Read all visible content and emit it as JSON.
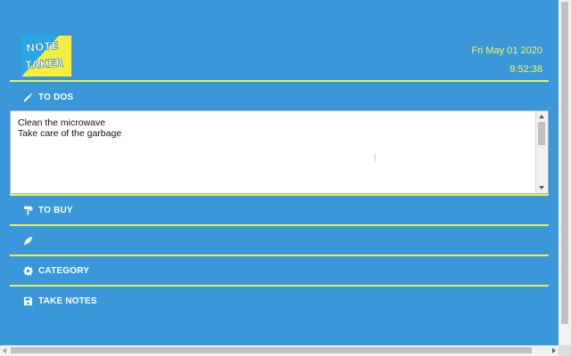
{
  "header": {
    "logo_line1": "NOTE",
    "logo_line2": "TAKER",
    "date": "Fri May 01 2020",
    "time": "9:52:38"
  },
  "sections": {
    "todos": "TO DOS",
    "tobuy": "TO BUY",
    "leaf": "",
    "category": "CATEGORY",
    "notes": "TAKE NOTES"
  },
  "todos_text": "Clean the microwave\nTake care of the garbage",
  "colors": {
    "background": "#3a97da",
    "accent_yellow": "#f0f04a",
    "text_white": "#ffffff"
  }
}
